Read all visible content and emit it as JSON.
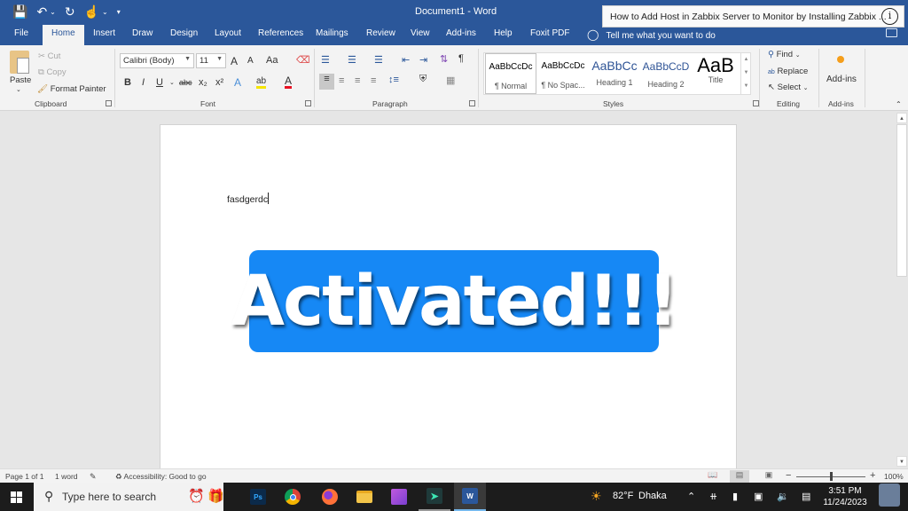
{
  "app": {
    "doc_title": "Document1  -  Word",
    "quick_access": [
      "save-icon",
      "undo-icon",
      "redo-icon",
      "touch-mode-icon",
      "customize-icon"
    ]
  },
  "notification": {
    "text": "How to Add Host in Zabbix Server to Monitor by Installing Zabbix ...",
    "icon": "i"
  },
  "tabs": [
    {
      "label": "File"
    },
    {
      "label": "Home",
      "active": true
    },
    {
      "label": "Insert"
    },
    {
      "label": "Draw"
    },
    {
      "label": "Design"
    },
    {
      "label": "Layout"
    },
    {
      "label": "References"
    },
    {
      "label": "Mailings"
    },
    {
      "label": "Review"
    },
    {
      "label": "View"
    },
    {
      "label": "Add-ins"
    },
    {
      "label": "Help"
    },
    {
      "label": "Foxit PDF"
    }
  ],
  "tell_me": "Tell me what you want to do",
  "ribbon": {
    "clipboard": {
      "label": "Clipboard",
      "paste": "Paste",
      "cut": "Cut",
      "copy": "Copy",
      "format_painter": "Format Painter"
    },
    "font": {
      "label": "Font",
      "font_name": "Calibri (Body)",
      "font_size": "11",
      "grow": "A",
      "shrink": "A",
      "change_case": "Aa",
      "bold": "B",
      "italic": "I",
      "underline": "U",
      "strikethrough": "abc",
      "subscript": "x₂",
      "superscript": "x²",
      "text_effects": "A",
      "highlight": "ab",
      "font_color": "A",
      "highlight_color": "#f5e500",
      "font_color_value": "#e81123"
    },
    "paragraph": {
      "label": "Paragraph"
    },
    "styles": {
      "label": "Styles",
      "items": [
        {
          "preview": "AaBbCcDc",
          "name": "¶ Normal",
          "selected": true
        },
        {
          "preview": "AaBbCcDc",
          "name": "¶ No Spac..."
        },
        {
          "preview": "AaBbCc",
          "name": "Heading 1"
        },
        {
          "preview": "AaBbCcD",
          "name": "Heading 2"
        },
        {
          "preview": "AaB",
          "name": "Title"
        }
      ]
    },
    "editing": {
      "label": "Editing",
      "find": "Find",
      "replace": "Replace",
      "select": "Select"
    },
    "addins": {
      "label": "Add-ins",
      "button": "Add-ins"
    }
  },
  "document": {
    "text": "fasdgerdc",
    "banner_text": "Activated!!!",
    "banner_color": "#1688f5"
  },
  "status": {
    "page": "Page 1 of 1",
    "words": "1 word",
    "accessibility": "Accessibility: Good to go",
    "zoom": "100%",
    "zoom_percent": 100
  },
  "taskbar": {
    "search_placeholder": "Type here to search",
    "apps": [
      "photoshop",
      "chrome",
      "firefox",
      "file-explorer",
      "clipchamp",
      "filmora",
      "word"
    ],
    "weather_temp": "82°F",
    "weather_city": "Dhaka",
    "time": "3:51 PM",
    "date": "11/24/2023"
  }
}
